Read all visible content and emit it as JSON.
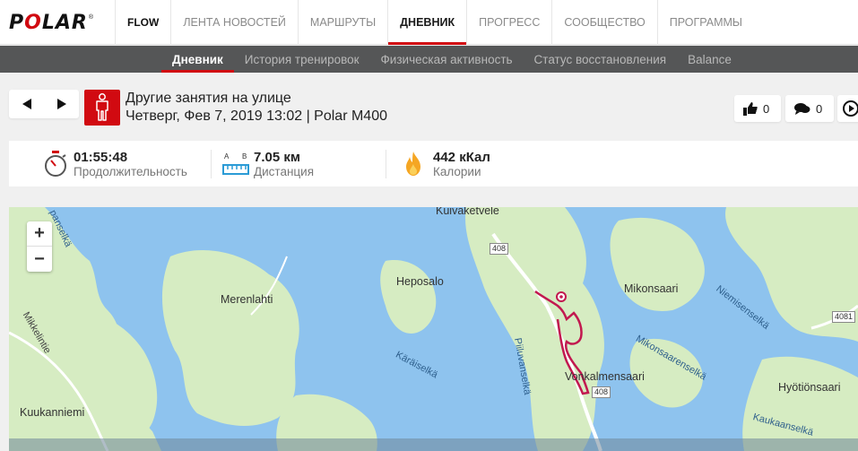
{
  "brand": {
    "logo_text": "POLAR",
    "app_name": "FLOW",
    "accent": "#d10a11"
  },
  "topnav": {
    "items": [
      {
        "label": "ЛЕНТА НОВОСТЕЙ"
      },
      {
        "label": "МАРШРУТЫ"
      },
      {
        "label": "ДНЕВНИК",
        "active": true
      },
      {
        "label": "ПРОГРЕСС"
      },
      {
        "label": "СООБЩЕСТВО"
      },
      {
        "label": "ПРОГРАММЫ"
      }
    ]
  },
  "subnav": {
    "items": [
      {
        "label": "Дневник",
        "active": true
      },
      {
        "label": "История тренировок"
      },
      {
        "label": "Физическая активность"
      },
      {
        "label": "Статус восстановления"
      },
      {
        "label": "Balance"
      }
    ]
  },
  "session": {
    "title": "Другие занятия на улице",
    "subtitle": "Четверг, Фев 7, 2019 13:02 | Polar M400",
    "sport_icon": "person-standing-icon",
    "likes": "0",
    "comments": "0"
  },
  "stats": {
    "duration": {
      "value": "01:55:48",
      "label": "Продолжительность",
      "icon": "stopwatch-icon"
    },
    "distance": {
      "value": "7.05 км",
      "label": "Дистанция",
      "icon": "ruler-icon",
      "marker_a": "A",
      "marker_b": "B"
    },
    "calories": {
      "value": "442 кКал",
      "label": "Калории",
      "icon": "flame-icon"
    }
  },
  "map": {
    "zoom_in": "+",
    "zoom_out": "−",
    "places": {
      "kuivaketvele": "Kuivaketvele",
      "heposalo": "Heposalo",
      "merenlahti": "Merenlahti",
      "mikonsaari": "Mikonsaari",
      "vonkalmensaari": "Vonkalmensaari",
      "kuukanniemi": "Kuukanniemi",
      "hyotionsaari": "Hyötiönsaari",
      "mikkelintie": "Mikkelintie"
    },
    "waters": {
      "kaiselka": "Käräiselkä",
      "piiluvanselka": "Piiluvanselkä",
      "mikonsaarenselka": "Mikonsaarenselkä",
      "niemisenselka": "Niemisenselkä",
      "kaukaanselka": "Kaukaanselkä",
      "vanselka": "panselkä"
    },
    "roads": {
      "r408a": "408",
      "r408b": "408",
      "r4081": "4081"
    },
    "route_color": "#c2184f"
  }
}
